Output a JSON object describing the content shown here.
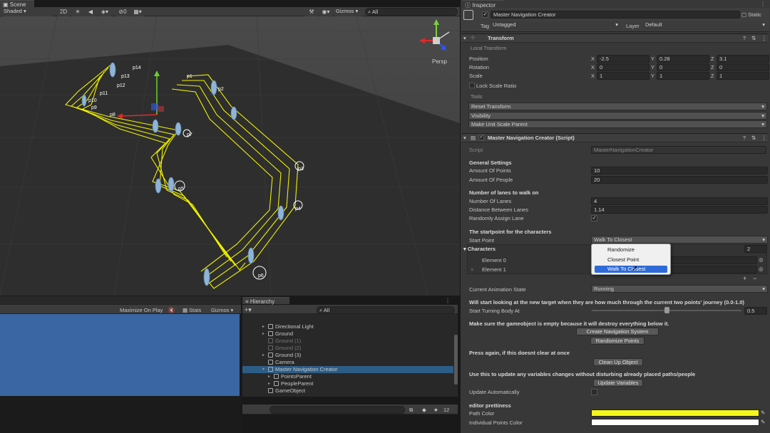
{
  "scene": {
    "tab": "Scene",
    "shading": "Shaded",
    "mode2d": "2D",
    "gizmos": "Gizmos",
    "search": "All",
    "persp": "Persp",
    "points": [
      "p1",
      "p2",
      "p3",
      "p4",
      "p5",
      "p6",
      "p7",
      "p8",
      "p9",
      "p10",
      "p11",
      "p12",
      "p13",
      "p14"
    ],
    "path_color": "#f0f000"
  },
  "game": {
    "maximize": "Maximize On Play",
    "stats": "Stats",
    "gizmos": "Gizmos",
    "bg": "#3a66a3"
  },
  "hierarchy": {
    "tab": "Hierarchy",
    "search": "All",
    "items": [
      {
        "label": "Directional Light",
        "dim": false,
        "indent": 0,
        "selected": false
      },
      {
        "label": "Ground",
        "dim": false,
        "indent": 0,
        "selected": false
      },
      {
        "label": "Ground (1)",
        "dim": true,
        "indent": 0,
        "selected": false
      },
      {
        "label": "Ground (2)",
        "dim": true,
        "indent": 0,
        "selected": false
      },
      {
        "label": "Ground (3)",
        "dim": false,
        "indent": 0,
        "selected": false
      },
      {
        "label": "Camera",
        "dim": false,
        "indent": 0,
        "selected": false
      },
      {
        "label": "Master Navigation Creator",
        "dim": false,
        "indent": 0,
        "selected": true
      },
      {
        "label": "PointsParent",
        "dim": false,
        "indent": 1,
        "selected": false
      },
      {
        "label": "PeopleParent",
        "dim": false,
        "indent": 1,
        "selected": false
      },
      {
        "label": "GameObject",
        "dim": false,
        "indent": 0,
        "selected": false
      }
    ],
    "count": "12"
  },
  "inspector": {
    "tab": "Inspector",
    "object_name": "Master Navigation Creator",
    "static": "Static",
    "tag_label": "Tag",
    "tag": "Untagged",
    "layer_label": "Layer",
    "layer": "Default",
    "transform": {
      "title": "Transform",
      "local": "Local Transform",
      "position_label": "Position",
      "rotation_label": "Rotation",
      "scale_label": "Scale",
      "position": [
        "-2.5",
        "0.28",
        "3.1"
      ],
      "rotation": [
        "0",
        "0",
        "0"
      ],
      "scale": [
        "1",
        "1",
        "1"
      ],
      "lock": "Lock Scale Ratio",
      "tools": "Tools",
      "reset": "Reset Transform",
      "visibility": "Visibility",
      "unit": "Make Unit Scale Parent"
    },
    "script": {
      "title": "Master Navigation Creator (Script)",
      "script_label": "Script",
      "script_value": "MasterNavigationCreator",
      "general": "General Settings",
      "amount_points_label": "Amount Of Points",
      "amount_points": "10",
      "amount_people_label": "Amount Of People",
      "amount_people": "20",
      "lanes_header": "Number of lanes to walk on",
      "lanes_label": "Number Of Lanes",
      "lanes": "4",
      "distance_label": "Distance Between Lanes",
      "distance": "1.14",
      "random_label": "Randomly Assign Lane",
      "start_header": "The startpoint for the characters",
      "start_label": "Start Point",
      "start_value": "Walk To Closest",
      "characters_label": "Characters",
      "characters_count": "2",
      "element0": "Element 0",
      "element1": "Element 1",
      "dropdown": [
        "Randomize",
        "Closest Point",
        "Walk To Closest"
      ],
      "anim_label": "Current Animation State",
      "anim": "Running",
      "turn_info": "Will start looking at the new target when they are how much through the current two points' journey (0.0-1.0)",
      "turn_label": "Start Turning Body At",
      "turn": "0.5",
      "turn_fraction": 0.5,
      "empty_info": "Make sure the gameobject is empty because it will destroy everything below it.",
      "create_btn": "Create Navigation System",
      "randomize_btn": "Randomize Points",
      "press_info": "Press again, if this doesnt clear at once",
      "cleanup_btn": "Clean Up Object",
      "update_info": "Use this to update any variables changes without disturbing already placed paths/people",
      "update_btn": "Update Variables",
      "auto_label": "Update Automatically",
      "pretty": "editor prettiness",
      "path_color_label": "Path Color",
      "points_color_label": "Individual Points Color",
      "path_color": "#f5f51a",
      "points_color": "#ffffff"
    }
  }
}
